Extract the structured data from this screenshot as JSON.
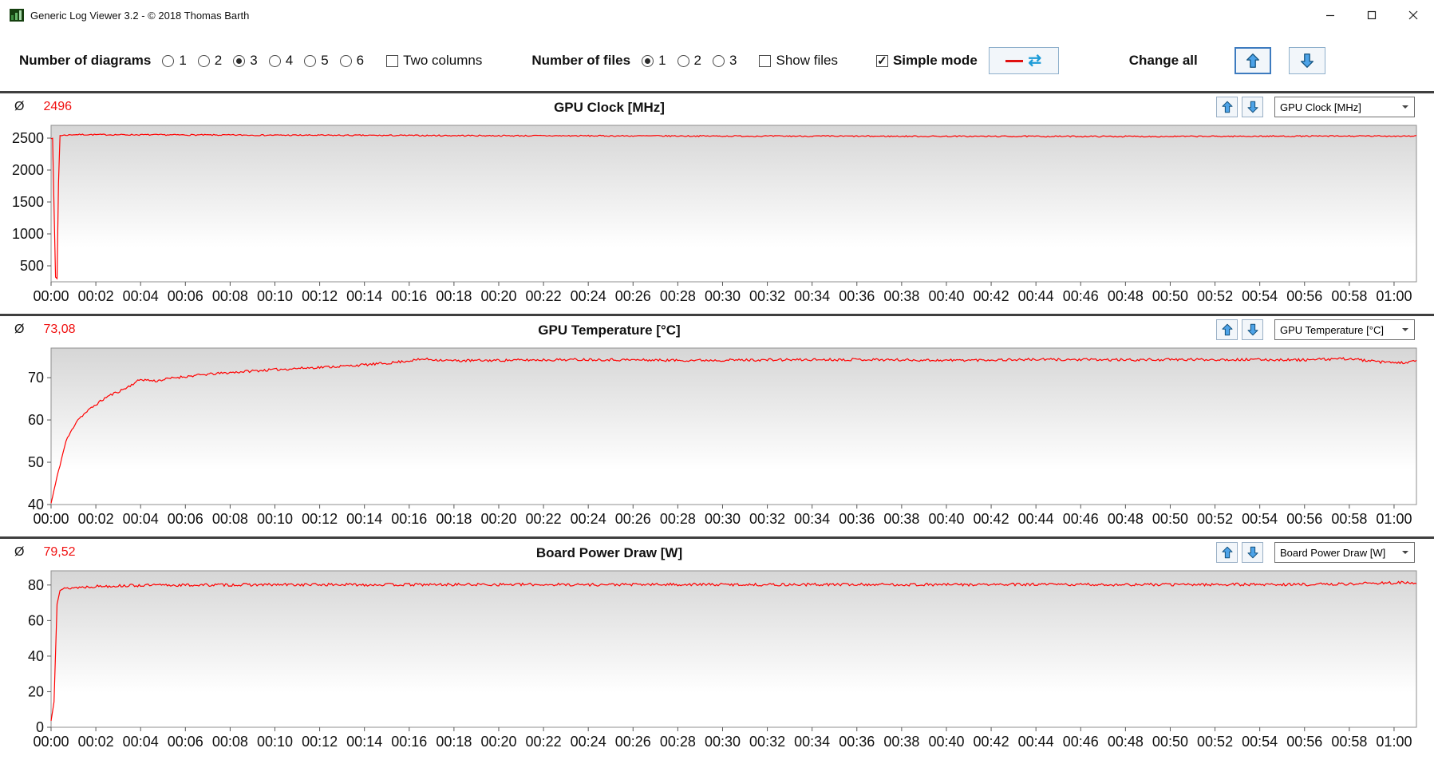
{
  "window": {
    "title": "Generic Log Viewer 3.2 - © 2018 Thomas Barth"
  },
  "icons": {
    "checkmark": "✓",
    "legend_refresh": "⇄"
  },
  "toolbar": {
    "diagrams": {
      "label": "Number of diagrams",
      "options": [
        "1",
        "2",
        "3",
        "4",
        "5",
        "6"
      ],
      "selected": "3"
    },
    "two_columns": {
      "label": "Two columns",
      "checked": false
    },
    "files": {
      "label": "Number of files",
      "options": [
        "1",
        "2",
        "3"
      ],
      "selected": "1"
    },
    "show_files": {
      "label": "Show files",
      "checked": false
    },
    "simple_mode": {
      "label": "Simple mode",
      "checked": true
    },
    "change_all_label": "Change all"
  },
  "time_axis": {
    "start": 0,
    "end": 3660,
    "tick_seconds_interval": 120,
    "tick_labels": [
      "00:00",
      "00:02",
      "00:04",
      "00:06",
      "00:08",
      "00:10",
      "00:12",
      "00:14",
      "00:16",
      "00:18",
      "00:20",
      "00:22",
      "00:24",
      "00:26",
      "00:28",
      "00:30",
      "00:32",
      "00:34",
      "00:36",
      "00:38",
      "00:40",
      "00:42",
      "00:44",
      "00:46",
      "00:48",
      "00:50",
      "00:52",
      "00:54",
      "00:56",
      "00:58",
      "01:00"
    ]
  },
  "chart_data": [
    {
      "type": "line",
      "title": "GPU Clock [MHz]",
      "avg_prefix": "Ø",
      "average_label": "2496",
      "selector_value": "GPU Clock [MHz]",
      "color": "#ff0000",
      "ylim": [
        250,
        2700
      ],
      "yticks": [
        500,
        1000,
        1500,
        2000,
        2500
      ],
      "noise": 10,
      "seed": 7,
      "keypoints": [
        [
          0,
          2500
        ],
        [
          6,
          2510
        ],
        [
          10,
          330
        ],
        [
          16,
          300
        ],
        [
          22,
          2540
        ],
        [
          60,
          2555
        ],
        [
          240,
          2552
        ],
        [
          600,
          2546
        ],
        [
          1200,
          2538
        ],
        [
          1800,
          2532
        ],
        [
          2400,
          2528
        ],
        [
          3000,
          2526
        ],
        [
          3300,
          2530
        ],
        [
          3600,
          2532
        ],
        [
          3660,
          2534
        ]
      ]
    },
    {
      "type": "line",
      "title": "GPU Temperature [°C]",
      "avg_prefix": "Ø",
      "average_label": "73,08",
      "selector_value": "GPU Temperature [°C]",
      "color": "#ff0000",
      "ylim": [
        40,
        77
      ],
      "yticks": [
        40,
        50,
        60,
        70
      ],
      "noise": 0.3,
      "seed": 11,
      "keypoints": [
        [
          0,
          40.3
        ],
        [
          20,
          48
        ],
        [
          40,
          55
        ],
        [
          70,
          60
        ],
        [
          110,
          63
        ],
        [
          150,
          65.5
        ],
        [
          200,
          67.5
        ],
        [
          240,
          69.6
        ],
        [
          280,
          69.2
        ],
        [
          330,
          70
        ],
        [
          420,
          70.8
        ],
        [
          540,
          71.6
        ],
        [
          660,
          72.2
        ],
        [
          780,
          72.7
        ],
        [
          900,
          73.4
        ],
        [
          1000,
          74.4
        ],
        [
          1080,
          74.0
        ],
        [
          1200,
          74.1
        ],
        [
          1440,
          74.3
        ],
        [
          1680,
          74.1
        ],
        [
          1920,
          74.2
        ],
        [
          2160,
          74.3
        ],
        [
          2400,
          74.1
        ],
        [
          2640,
          74.3
        ],
        [
          2880,
          74.2
        ],
        [
          3120,
          74.3
        ],
        [
          3360,
          74.2
        ],
        [
          3480,
          74.5
        ],
        [
          3560,
          73.7
        ],
        [
          3620,
          73.5
        ],
        [
          3660,
          73.9
        ]
      ]
    },
    {
      "type": "line",
      "title": "Board Power Draw [W]",
      "avg_prefix": "Ø",
      "average_label": "79,52",
      "selector_value": "Board Power Draw [W]",
      "color": "#ff0000",
      "ylim": [
        0,
        88
      ],
      "yticks": [
        0,
        20,
        40,
        60,
        80
      ],
      "noise": 0.8,
      "seed": 13,
      "keypoints": [
        [
          0,
          3.5
        ],
        [
          8,
          15
        ],
        [
          16,
          70
        ],
        [
          24,
          77.5
        ],
        [
          60,
          78.5
        ],
        [
          120,
          79.3
        ],
        [
          240,
          79.8
        ],
        [
          480,
          80.1
        ],
        [
          720,
          80.2
        ],
        [
          960,
          80.2
        ],
        [
          1200,
          80.3
        ],
        [
          1440,
          80.2
        ],
        [
          1680,
          80.3
        ],
        [
          1920,
          80.2
        ],
        [
          2160,
          80.3
        ],
        [
          2400,
          80.2
        ],
        [
          2640,
          80.3
        ],
        [
          2880,
          80.2
        ],
        [
          3120,
          80.3
        ],
        [
          3360,
          80.3
        ],
        [
          3480,
          80.6
        ],
        [
          3560,
          81.2
        ],
        [
          3620,
          81.3
        ],
        [
          3660,
          81.0
        ]
      ]
    }
  ]
}
